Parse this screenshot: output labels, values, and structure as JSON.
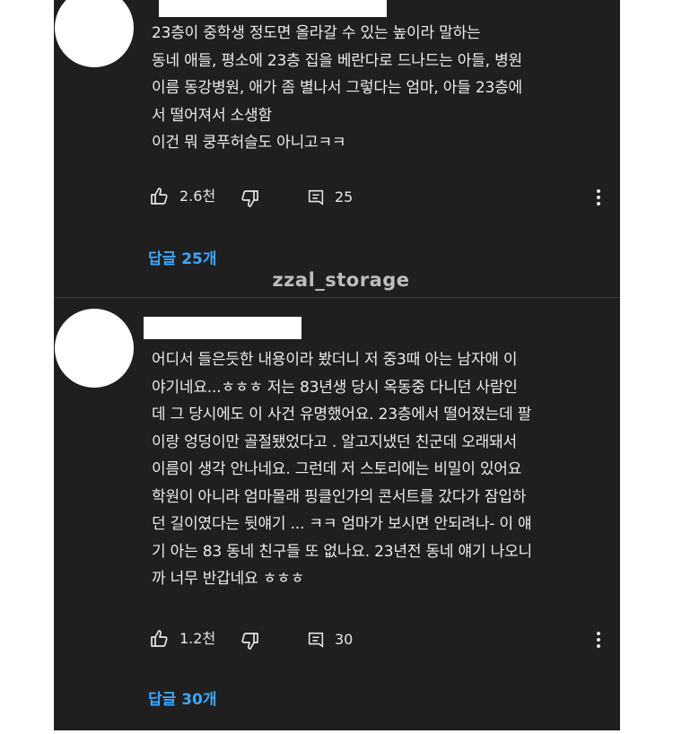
{
  "watermark": "zzal_storage",
  "colors": {
    "background": "#1f1f1f",
    "text": "#ececec",
    "link": "#3ea6ff"
  },
  "comments": [
    {
      "lines": [
        "23층이 중학생 정도면 올라갈 수 있는 높이라 말하는",
        "동네 애들, 평소에 23층 집을 베란다로 드나드는 아들, 병원",
        "이름 동강병원, 애가 좀 별나서 그렇다는 엄마, 아들 23층에",
        "서 떨어져서 소생함",
        "이건 뭐 쿵푸허슬도 아니고ㅋㅋ"
      ],
      "likes": "2.6천",
      "reply_count": "25",
      "replies_link": "답글 25개",
      "icons": [
        "thumbs-up-icon",
        "thumbs-down-icon",
        "reply-icon",
        "more-vert-icon"
      ]
    },
    {
      "lines": [
        "어디서 들은듯한 내용이라 봤더니 저 중3때 아는 남자애 이",
        "야기네요...ㅎㅎㅎ 저는 83년생 당시 옥동중 다니던 사람인",
        "데 그 당시에도 이 사건 유명했어요. 23층에서 떨어졌는데 팔",
        "이랑 엉덩이만 골절됐었다고 . 알고지냈던 친군데 오래돼서",
        "이름이 생각 안나네요. 그런데 저 스토리에는 비밀이 있어요",
        "학원이 아니라 엄마몰래 핑클인가의 콘서트를 갔다가 잠입하",
        "던 길이였다는 뒷얘기 ... ㅋㅋ 엄마가 보시면 안되려나- 이 얘",
        "기 아는 83 동네 친구들 또 없나요. 23년전 동네 얘기 나오니",
        "까 너무 반갑네요 ㅎㅎㅎ"
      ],
      "likes": "1.2천",
      "reply_count": "30",
      "replies_link": "답글 30개",
      "icons": [
        "thumbs-up-icon",
        "thumbs-down-icon",
        "reply-icon",
        "more-vert-icon"
      ]
    }
  ]
}
